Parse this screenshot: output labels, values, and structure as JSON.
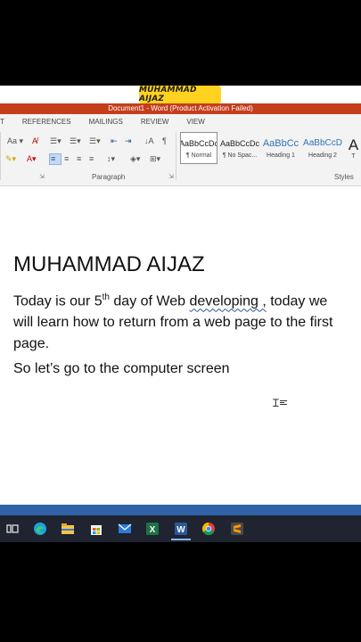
{
  "watermark": "MUHAMMAD AIJAZ",
  "window": {
    "title": "Document1 -  Word (Product Activation Failed)"
  },
  "menu": [
    "T",
    "REFERENCES",
    "MAILINGS",
    "REVIEW",
    "VIEW"
  ],
  "ribbon": {
    "paragraph_label": "Paragraph",
    "styles_label": "Styles",
    "font_size_btn": "Aa",
    "pilcrow": "¶",
    "styles": [
      {
        "preview": "AaBbCcDc",
        "name": "¶ Normal"
      },
      {
        "preview": "AaBbCcDc",
        "name": "¶ No Spac..."
      },
      {
        "preview": "AaBbCc",
        "name": "Heading 1"
      },
      {
        "preview": "AaBbCcD",
        "name": "Heading 2"
      },
      {
        "preview": "A",
        "name": "T"
      }
    ]
  },
  "document": {
    "heading": "MUHAMMAD AIJAZ",
    "para1_a": "Today is our 5",
    "para1_sup": "th",
    "para1_b": " day of Web ",
    "para1_squiggle": "developing ,",
    "para1_c": " today we",
    "para1_line2": "will learn how to return from a web page to the first",
    "para1_line3": "page.",
    "para2": "So let’s go to the computer screen"
  },
  "taskbar": {
    "icons": [
      "task-view-icon",
      "edge-icon",
      "file-explorer-icon",
      "store-icon",
      "mail-icon",
      "excel-icon",
      "word-icon",
      "chrome-icon",
      "sublime-text-icon"
    ]
  },
  "colors": {
    "word_brand": "#c43e1c",
    "accent_blue": "#2b579a",
    "watermark_bg": "#ffd21f",
    "taskbar": "#1f2430"
  }
}
